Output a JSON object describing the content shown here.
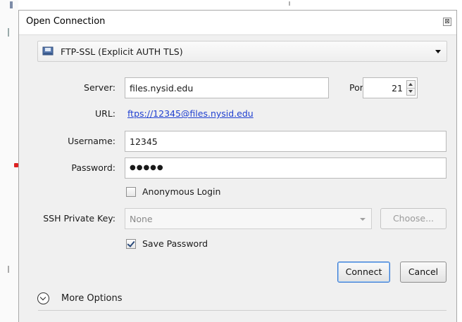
{
  "dialog": {
    "title": "Open Connection",
    "close_glyph": "⊠"
  },
  "protocol": {
    "icon": "disk-icon",
    "selected": "FTP-SSL (Explicit AUTH TLS)"
  },
  "server": {
    "label": "Server:",
    "value": "files.nysid.edu"
  },
  "port": {
    "label": "Port:",
    "value": "21"
  },
  "url": {
    "label": "URL:",
    "value": "ftps://12345@files.nysid.edu"
  },
  "username": {
    "label": "Username:",
    "value": "12345"
  },
  "password": {
    "label": "Password:",
    "value": "●●●●●"
  },
  "anonymous_login": {
    "label": "Anonymous Login",
    "checked": false
  },
  "ssh_key": {
    "label": "SSH Private Key:",
    "value": "None",
    "choose_label": "Choose..."
  },
  "save_password": {
    "label": "Save Password",
    "checked": true
  },
  "buttons": {
    "connect": "Connect",
    "cancel": "Cancel"
  },
  "more_options": {
    "label": "More Options"
  },
  "colors": {
    "link": "#1f3fd1",
    "dialog_bg": "#f0f0f0",
    "default_button_border": "#3a7bd5"
  }
}
